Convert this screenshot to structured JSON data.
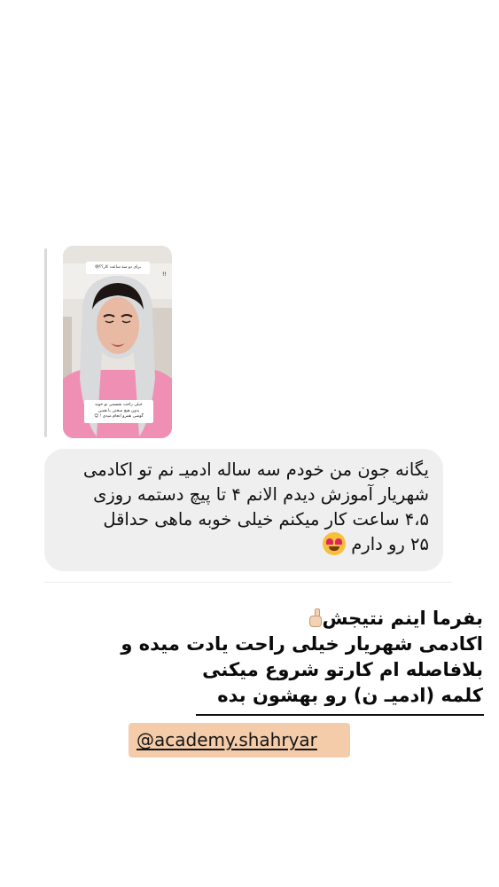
{
  "story_reply": {
    "sticker_text": "برای دو سه ساعت کار؟؟😅",
    "sticker_mark": "!!",
    "caption_lines": [
      "خیلی راحت نشستی تو خونه",
      "بدون هیچ سختی با همین",
      "گوشی همرو انجام میدی ! 😊"
    ]
  },
  "message": {
    "lines": [
      "یگانه جون من خودم سه ساله ادمیـ نم تو اکادمی",
      "شهریار آموزش دیدم الانم ۴ تا پیچ دستمه روزی",
      "۴،۵ ساعت کار میکنم خیلی خوبه ماهی حداقل",
      "۲۵ رو دارم"
    ],
    "emoji": "heart-eyes-icon"
  },
  "caption": {
    "lines": [
      "بفرما اینم نتیجش",
      "اکادمی شهریار  خیلی راحت یادت میده و",
      "بلافاصله ام کارتو شروع میکنی",
      "کلمه (ادمیـ ن) رو بهشون بده"
    ],
    "icon": "pointing-hand-icon"
  },
  "handle": {
    "text": "@academy.shahryar",
    "background": "#f5ccaa"
  },
  "colors": {
    "bubble": "#efefef",
    "page": "#ffffff"
  }
}
